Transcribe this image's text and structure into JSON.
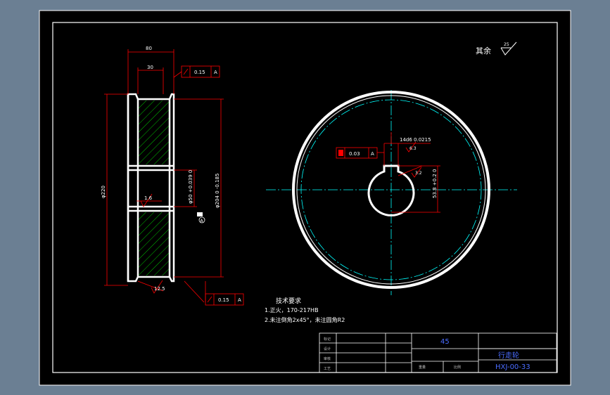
{
  "drawing": {
    "surface_finish": {
      "label": "其余",
      "value": "25"
    },
    "left_view": {
      "dim_width_outer": "80",
      "dim_width_inner": "30",
      "dim_outer_diameter": "φ220",
      "dim_bore_a": "φ50 +0.039 0",
      "dim_hub": "φ204 0 -0.185",
      "roughness_hub": "1.6",
      "roughness_rim": "12.5",
      "datum": "A",
      "tolerance_top": {
        "symbol": "↗",
        "value": "0.15",
        "datum": "A"
      },
      "tolerance_bottom": {
        "symbol": "↗",
        "value": "0.15",
        "datum": "A"
      }
    },
    "right_view": {
      "keyway_label": "14d6 0.0215",
      "tolerance_keyway": {
        "value": "0.03",
        "datum": "A"
      },
      "dim_key_depth": "53.8 +0.2 0",
      "roughness_key": "3.2",
      "roughness_key_side": "6.3"
    },
    "notes": {
      "title": "技术要求",
      "lines": [
        "1.正火，170-217HB",
        "2.未注倒角2x45°，未注圆角R2"
      ]
    },
    "title_block": {
      "material": "45",
      "part_name": "行走轮",
      "drawing_number": "HXJ-00-33",
      "row_labels": [
        "标记",
        "设计",
        "审核",
        "工艺"
      ],
      "cells": [
        "重量",
        "比例"
      ]
    }
  },
  "colors": {
    "background": "#000000",
    "frame": "#ffffff",
    "dimension": "#ff0000",
    "centerline": "#00ffff",
    "hatch": "#00ff00",
    "title_text": "#4a6cff"
  }
}
